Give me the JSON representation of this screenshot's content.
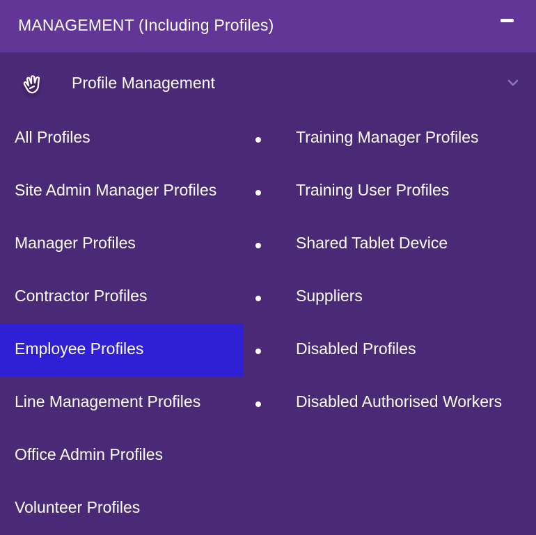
{
  "section": {
    "title": "MANAGEMENT (Including Profiles)",
    "toggle_icon": "minus-icon"
  },
  "subsection": {
    "title": "Profile Management",
    "icon": "waving-hand-icon",
    "chevron_icon": "chevron-down-icon"
  },
  "left_items": [
    {
      "label": "All Profiles"
    },
    {
      "label": "Site Admin Manager Profiles"
    },
    {
      "label": "Manager Profiles"
    },
    {
      "label": "Contractor Profiles"
    },
    {
      "label": "Employee Profiles",
      "active": true
    },
    {
      "label": "Line Management Profiles"
    },
    {
      "label": "Office Admin Profiles"
    },
    {
      "label": "Volunteer Profiles"
    }
  ],
  "right_items": [
    {
      "label": "Training Manager Profiles"
    },
    {
      "label": "Training User Profiles"
    },
    {
      "label": "Shared Tablet Device"
    },
    {
      "label": "Suppliers"
    },
    {
      "label": "Disabled Profiles"
    },
    {
      "label": "Disabled Authorised Workers"
    }
  ],
  "colors": {
    "background": "#4a2a76",
    "header": "#613696",
    "active_item": "#2f20d6",
    "text": "#ffffff"
  }
}
